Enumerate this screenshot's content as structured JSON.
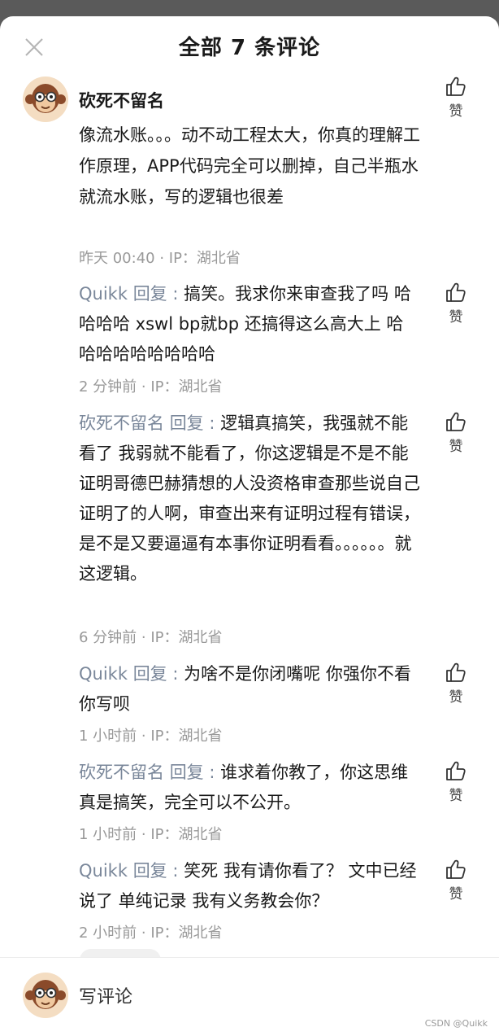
{
  "header": {
    "title": "全部 7 条评论",
    "close_icon": "close-icon"
  },
  "main_comment": {
    "author": "砍死不留名",
    "text": "像流水账。。。动不动工程太大，你真的理解工作原理，APP代码完全可以删掉，自己半瓶水就流水账，写的逻辑也很差",
    "meta": "昨天 00:40 · IP：湖北省",
    "like_label": "赞"
  },
  "replies": [
    {
      "author": "Quikk",
      "reply_word": "回复",
      "sep": ":",
      "text": "搞笑。我求你来审查我了吗 哈哈哈哈 xswl bp就bp 还搞得这么高大上 哈哈哈哈哈哈哈哈哈",
      "meta": "2 分钟前 · IP：湖北省",
      "like_label": "赞"
    },
    {
      "author": "砍死不留名",
      "reply_word": "回复",
      "sep": ":",
      "text": "逻辑真搞笑，我强就不能看了 我弱就不能看了，你这逻辑是不是不能证明哥德巴赫猜想的人没资格审查那些说自己证明了的人啊，审查出来有证明过程有错误，是不是又要逼逼有本事你证明看看。。。。。。就这逻辑。",
      "meta": "6 分钟前 · IP：湖北省",
      "like_label": "赞"
    },
    {
      "author": "Quikk",
      "reply_word": "回复",
      "sep": ":",
      "text": "为啥不是你闭嘴呢 你强你不看 你写呗",
      "meta": "1 小时前 · IP：湖北省",
      "like_label": "赞"
    },
    {
      "author": "砍死不留名",
      "reply_word": "回复",
      "sep": ":",
      "text": "谁求着你教了，你这思维真是搞笑，完全可以不公开。",
      "meta": "1 小时前 · IP：湖北省",
      "like_label": "赞"
    },
    {
      "author": "Quikk",
      "reply_word": "回复",
      "sep": ":",
      "text": "笑死 我有请你看了？ 文中已经说了 单纯记录 我有义务教会你？",
      "meta": "2 小时前 · IP：湖北省",
      "like_label": "赞"
    }
  ],
  "footer": {
    "placeholder": "写评论"
  },
  "watermark": "CSDN @Quikk"
}
